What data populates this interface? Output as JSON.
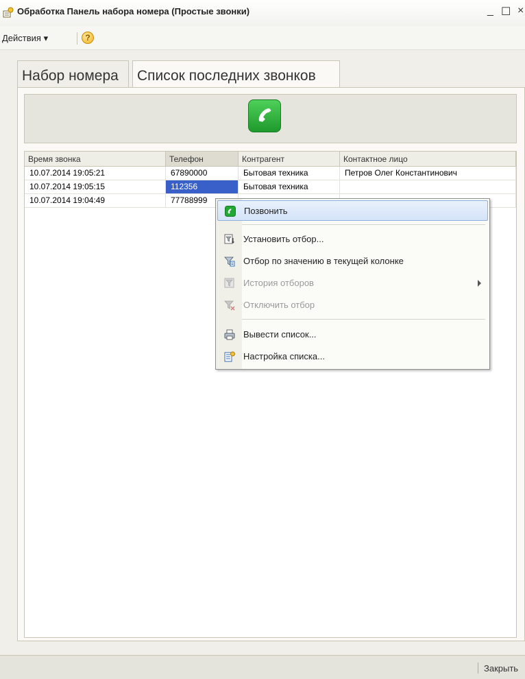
{
  "window": {
    "title": "Обработка  Панель набора номера (Простые звонки)",
    "controls": [
      "_",
      "☐",
      "×"
    ]
  },
  "menubar": {
    "actions_label": "Действия ▾",
    "help_icon": "question-circle-icon"
  },
  "tabs": [
    {
      "label": "Набор номера",
      "active": false
    },
    {
      "label": "Список последних звонков",
      "active": true
    }
  ],
  "call_panel": {
    "call_icon": "phone-call-icon",
    "accent": "#2db53a"
  },
  "table": {
    "columns": [
      "Время звонка",
      "Телефон",
      "Контрагент",
      "Контактное лицо"
    ],
    "sorted_column": "Телефон",
    "rows": [
      {
        "time": "10.07.2014 19:05:21",
        "phone": "67890000",
        "counterparty": "Бытовая техника",
        "contact": "Петров Олег Константинович"
      },
      {
        "time": "10.07.2014 19:05:15",
        "phone": "112356",
        "counterparty": "Бытовая техника",
        "contact": ""
      },
      {
        "time": "10.07.2014 19:04:49",
        "phone": "77788999",
        "counterparty": "",
        "contact": ""
      }
    ],
    "selected": {
      "row": 1,
      "column": "Телефон"
    },
    "selection_color": "#3860c8"
  },
  "context_menu": {
    "items": [
      {
        "label": "Позвонить",
        "icon": "phone-call-icon",
        "enabled": true,
        "highlighted": true
      },
      {
        "label": "Установить отбор...",
        "icon": "filter-set-icon",
        "enabled": true
      },
      {
        "label": "Отбор по значению в текущей колонке",
        "icon": "filter-by-value-icon",
        "enabled": true
      },
      {
        "label": "История отборов",
        "icon": "filter-history-icon",
        "enabled": false,
        "submenu": true
      },
      {
        "label": "Отключить отбор",
        "icon": "filter-off-icon",
        "enabled": false
      },
      {
        "label": "Вывести список...",
        "icon": "print-list-icon",
        "enabled": true
      },
      {
        "label": "Настройка списка...",
        "icon": "list-settings-icon",
        "enabled": true
      }
    ]
  },
  "statusbar": {
    "close_label": "Закрыть"
  }
}
